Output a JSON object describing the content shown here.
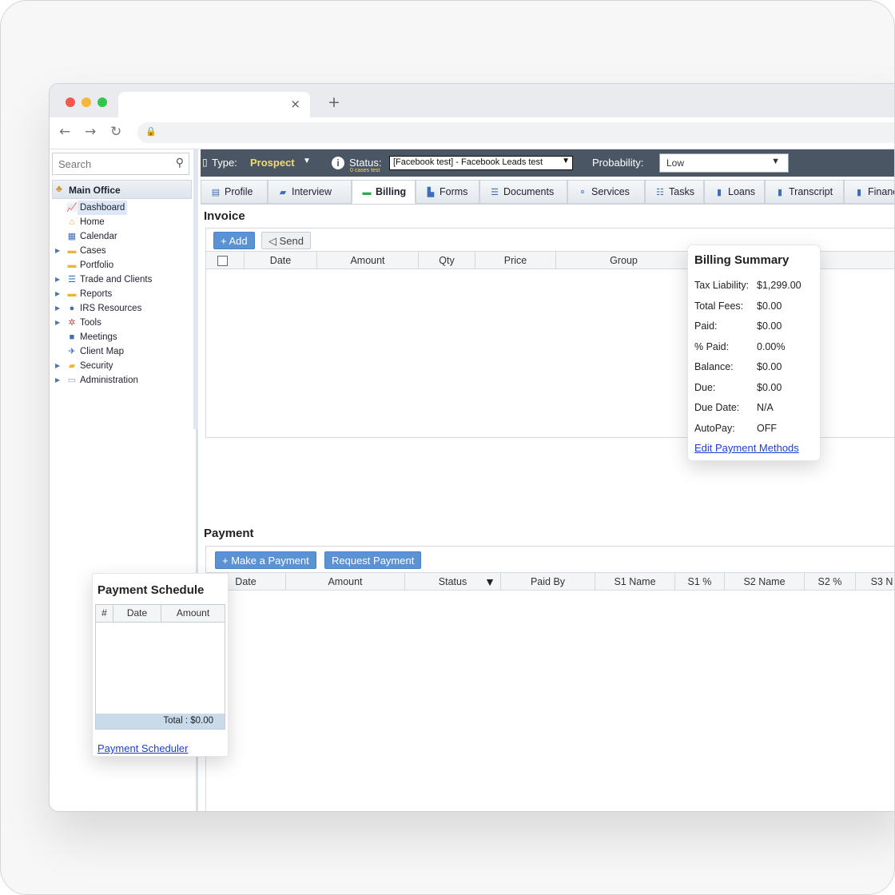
{
  "browser": {
    "tab_close": "×",
    "new_tab": "+",
    "back": "←",
    "forward": "→",
    "reload": "↻",
    "lock": "🔒"
  },
  "sidebar": {
    "search_placeholder": "Search",
    "root": "Main Office",
    "items": [
      {
        "label": "Dashboard",
        "icon": "dashboard-icon",
        "glyph": "📈",
        "color": "#3c6fb5",
        "arrow": ""
      },
      {
        "label": "Home",
        "icon": "home-icon",
        "glyph": "⌂",
        "color": "#e0a020",
        "arrow": ""
      },
      {
        "label": "Calendar",
        "icon": "calendar-icon",
        "glyph": "▦",
        "color": "#3c6fb5",
        "arrow": ""
      },
      {
        "label": "Cases",
        "icon": "folder-icon",
        "glyph": "▬",
        "color": "#e6b83a",
        "arrow": "▶"
      },
      {
        "label": "Portfolio",
        "icon": "portfolio-icon",
        "glyph": "▬",
        "color": "#e6b83a",
        "arrow": ""
      },
      {
        "label": "Trade and Clients",
        "icon": "trade-icon",
        "glyph": "☰",
        "color": "#3c6fb5",
        "arrow": "▶"
      },
      {
        "label": "Reports",
        "icon": "reports-icon",
        "glyph": "▬",
        "color": "#e6b83a",
        "arrow": "▶"
      },
      {
        "label": "IRS Resources",
        "icon": "irs-icon",
        "glyph": "●",
        "color": "#3c6fb5",
        "arrow": "▶"
      },
      {
        "label": "Tools",
        "icon": "tools-icon",
        "glyph": "✲",
        "color": "#c0504d",
        "arrow": "▶"
      },
      {
        "label": "Meetings",
        "icon": "meetings-icon",
        "glyph": "■",
        "color": "#3c6fb5",
        "arrow": ""
      },
      {
        "label": "Client Map",
        "icon": "map-icon",
        "glyph": "✈",
        "color": "#3c6fb5",
        "arrow": ""
      },
      {
        "label": "Security",
        "icon": "lock-icon",
        "glyph": "▰",
        "color": "#e6b83a",
        "arrow": "▶"
      },
      {
        "label": "Administration",
        "icon": "admin-icon",
        "glyph": "▭",
        "color": "#8aa0c0",
        "arrow": "▶"
      }
    ]
  },
  "toolbar": {
    "type_label": "Type:",
    "type_value": "Prospect",
    "status_label": "Status:",
    "status_value": "[Facebook test] - Facebook Leads test",
    "status_sub": "0 cases test",
    "probability_label": "Probability:",
    "probability_value": "Low"
  },
  "tabs": [
    {
      "label": "Profile",
      "glyph": "▤"
    },
    {
      "label": "Interview",
      "glyph": "▰"
    },
    {
      "label": "Billing",
      "glyph": "▬"
    },
    {
      "label": "Forms",
      "glyph": "▙"
    },
    {
      "label": "Documents",
      "glyph": "☰"
    },
    {
      "label": "Services",
      "glyph": "⚬"
    },
    {
      "label": "Tasks",
      "glyph": "☷"
    },
    {
      "label": "Loans",
      "glyph": "▮"
    },
    {
      "label": "Transcript",
      "glyph": "▮"
    },
    {
      "label": "Financ",
      "glyph": "▮"
    }
  ],
  "invoice": {
    "title": "Invoice",
    "add_label": "+ Add",
    "send_label": "◁ Send",
    "columns": [
      "Date",
      "Amount",
      "Qty",
      "Price",
      "Group"
    ]
  },
  "billing_summary": {
    "title": "Billing Summary",
    "rows": [
      {
        "k": "Tax Liability:",
        "v": "$1,299.00"
      },
      {
        "k": "Total Fees:",
        "v": "$0.00"
      },
      {
        "k": "Paid:",
        "v": "$0.00"
      },
      {
        "k": "% Paid:",
        "v": "0.00%"
      },
      {
        "k": "Balance:",
        "v": "$0.00"
      },
      {
        "k": "Due:",
        "v": "$0.00"
      },
      {
        "k": "Due Date:",
        "v": "N/A"
      },
      {
        "k": "AutoPay:",
        "v": "OFF"
      }
    ],
    "link": "Edit Payment Methods"
  },
  "payment": {
    "title": "Payment",
    "make_label": "+ Make a Payment",
    "request_label": "Request Payment",
    "columns": [
      "Date",
      "Amount",
      "Status",
      "Paid By",
      "S1 Name",
      "S1 %",
      "S2 Name",
      "S2 %",
      "S3 N"
    ]
  },
  "schedule": {
    "title": "Payment Schedule",
    "columns": [
      "#",
      "Date",
      "Amount"
    ],
    "total": "Total : $0.00",
    "link": "Payment Scheduler"
  }
}
